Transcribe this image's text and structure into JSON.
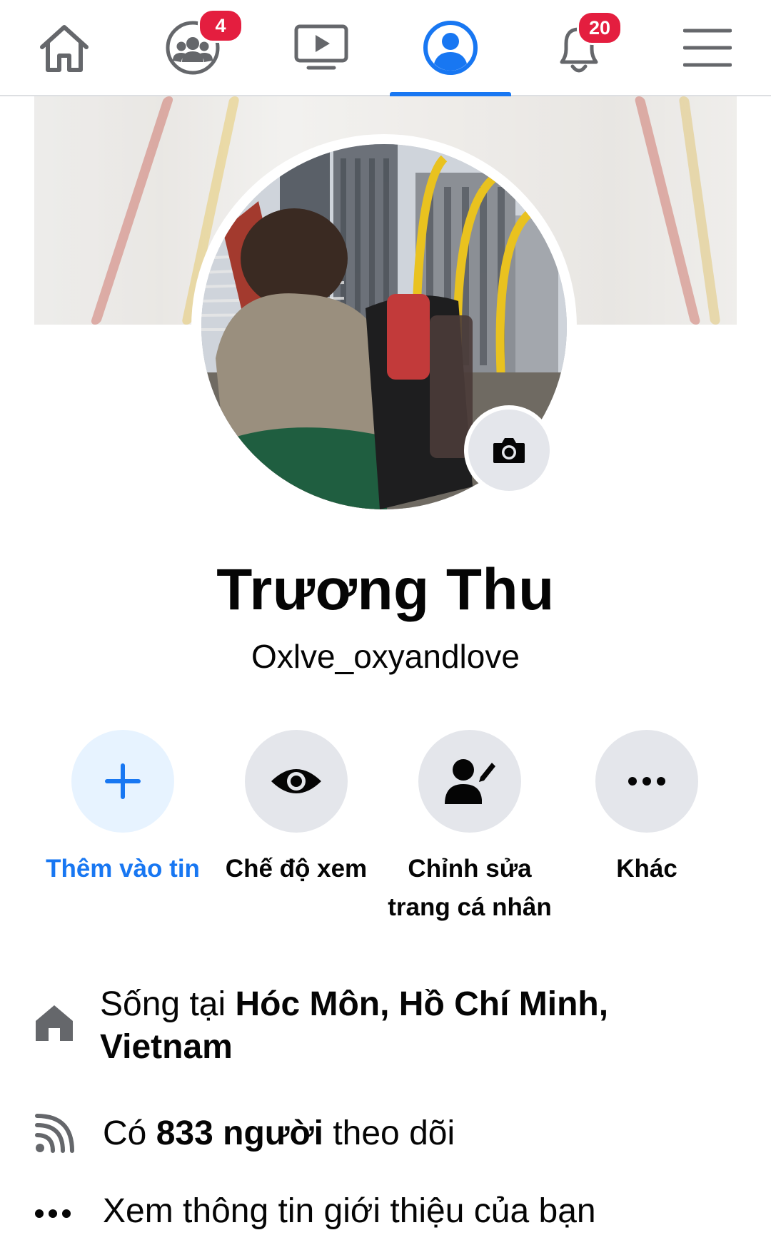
{
  "nav": {
    "items": [
      {
        "name": "home",
        "icon": "home-icon"
      },
      {
        "name": "friends",
        "icon": "friends-icon",
        "badge": "4"
      },
      {
        "name": "watch",
        "icon": "video-icon"
      },
      {
        "name": "profile",
        "icon": "profile-icon",
        "active": true
      },
      {
        "name": "notifications",
        "icon": "bell-icon",
        "badge": "20"
      },
      {
        "name": "menu",
        "icon": "hamburger-menu-icon"
      }
    ]
  },
  "profile": {
    "name": "Trương Thu",
    "subtitle": "Oxlve_oxyandlove"
  },
  "actions": [
    {
      "label": "Thêm vào tin",
      "icon": "plus-icon",
      "accent": true
    },
    {
      "label": "Chế độ xem",
      "icon": "eye-icon"
    },
    {
      "label": "Chỉnh sửa trang cá nhân",
      "icon": "edit-person-icon"
    },
    {
      "label": "Khác",
      "icon": "more-dots-icon"
    }
  ],
  "info": {
    "lives_prefix": "Sống tại ",
    "lives_place": "Hóc Môn, Hồ Chí Minh, Vietnam",
    "followers_prefix": "Có ",
    "followers_bold": "833 người",
    "followers_suffix": " theo dõi",
    "about_link": "Xem thông tin giới thiệu của bạn"
  },
  "colors": {
    "accent": "#1877f2",
    "badge": "#e41e3f",
    "button_bg": "#e4e6eb",
    "accent_button_bg": "#e7f3ff"
  }
}
